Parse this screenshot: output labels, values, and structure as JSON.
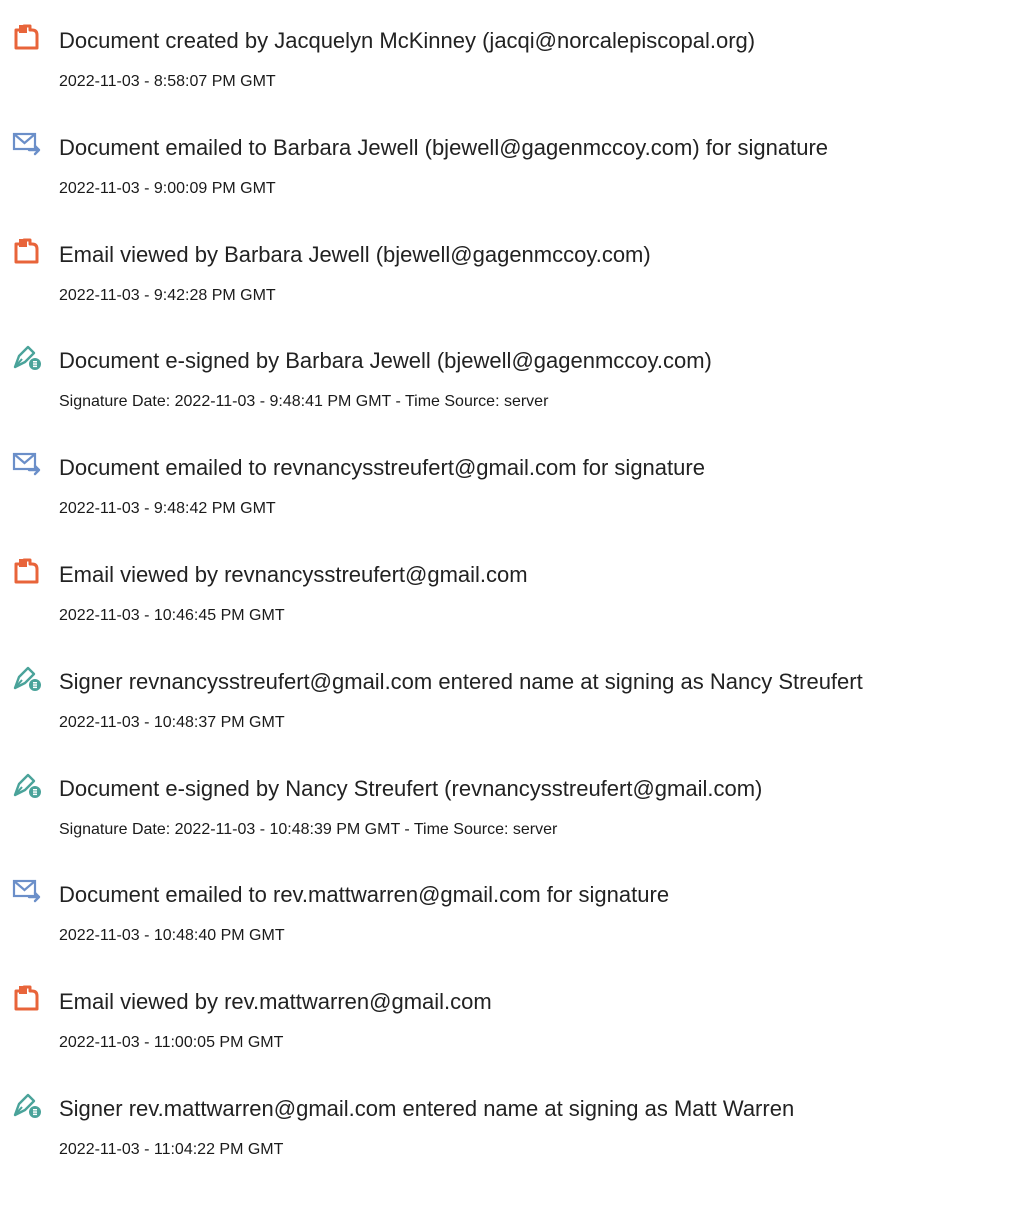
{
  "events": [
    {
      "icon": "document-icon",
      "desc": "Document created by Jacquelyn McKinney (jacqi@norcalepiscopal.org)",
      "ts": "2022-11-03 - 8:58:07 PM GMT"
    },
    {
      "icon": "email-sent-icon",
      "desc": "Document emailed to Barbara Jewell (bjewell@gagenmccoy.com) for signature",
      "ts": "2022-11-03 - 9:00:09 PM GMT"
    },
    {
      "icon": "document-icon",
      "desc": "Email viewed by Barbara Jewell (bjewell@gagenmccoy.com)",
      "ts": "2022-11-03 - 9:42:28 PM GMT"
    },
    {
      "icon": "esign-pen-icon",
      "desc": "Document e-signed by Barbara Jewell (bjewell@gagenmccoy.com)",
      "ts": "Signature Date: 2022-11-03 - 9:48:41 PM GMT - Time Source: server"
    },
    {
      "icon": "email-sent-icon",
      "desc": "Document emailed to revnancysstreufert@gmail.com for signature",
      "ts": "2022-11-03 - 9:48:42 PM GMT"
    },
    {
      "icon": "document-icon",
      "desc": "Email viewed by revnancysstreufert@gmail.com",
      "ts": "2022-11-03 - 10:46:45 PM GMT"
    },
    {
      "icon": "esign-pen-icon",
      "desc": "Signer revnancysstreufert@gmail.com entered name at signing as Nancy Streufert",
      "ts": "2022-11-03 - 10:48:37 PM GMT"
    },
    {
      "icon": "esign-pen-icon",
      "desc": "Document e-signed by Nancy Streufert (revnancysstreufert@gmail.com)",
      "ts": "Signature Date: 2022-11-03 - 10:48:39 PM GMT - Time Source: server"
    },
    {
      "icon": "email-sent-icon",
      "desc": "Document emailed to rev.mattwarren@gmail.com for signature",
      "ts": "2022-11-03 - 10:48:40 PM GMT"
    },
    {
      "icon": "document-icon",
      "desc": "Email viewed by rev.mattwarren@gmail.com",
      "ts": "2022-11-03 - 11:00:05 PM GMT"
    },
    {
      "icon": "esign-pen-icon",
      "desc": "Signer rev.mattwarren@gmail.com entered name at signing as Matt Warren",
      "ts": "2022-11-03 - 11:04:22 PM GMT"
    }
  ],
  "colors": {
    "document_icon": "#e8643a",
    "email_icon": "#6b8fc9",
    "esign_icon": "#4aa39a"
  }
}
